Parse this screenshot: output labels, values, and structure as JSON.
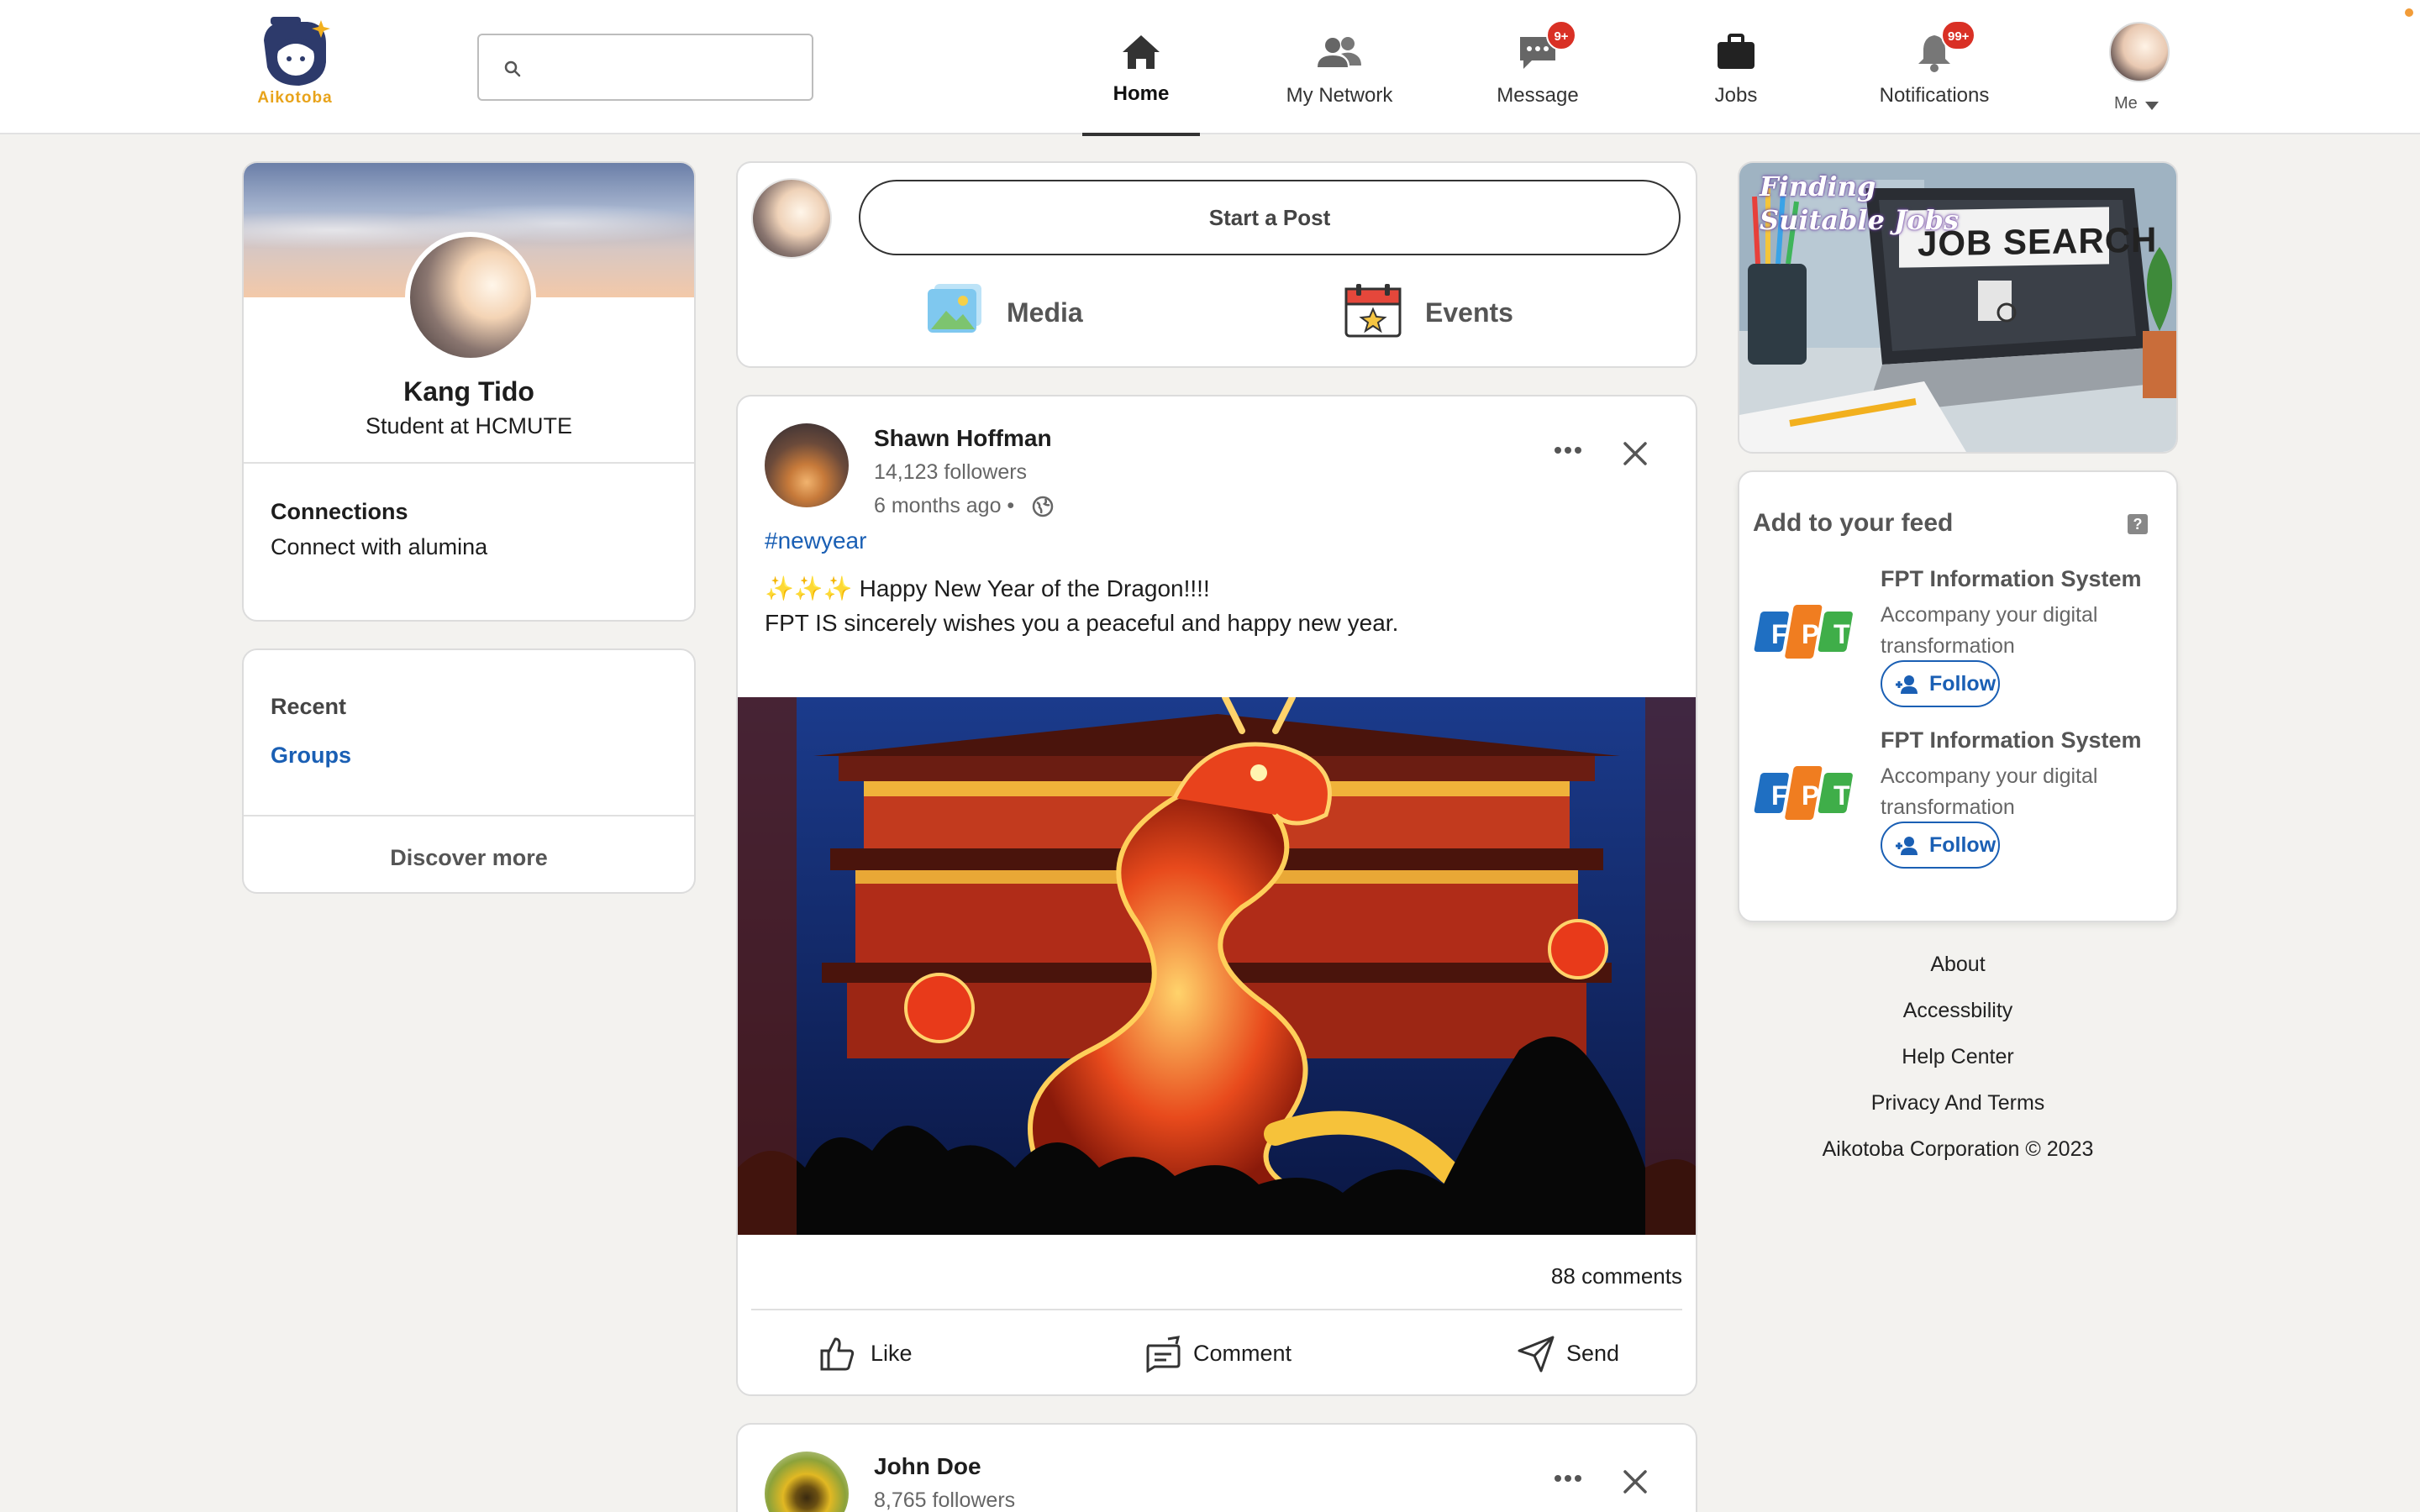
{
  "header": {
    "logo_text": "Aikotoba",
    "search": {
      "placeholder": "",
      "value": ""
    },
    "nav": [
      {
        "id": "home",
        "label": "Home",
        "icon": "home-icon",
        "active": true,
        "badge": ""
      },
      {
        "id": "network",
        "label": "My Network",
        "icon": "people-icon",
        "active": false,
        "badge": ""
      },
      {
        "id": "message",
        "label": "Message",
        "icon": "chat-icon",
        "active": false,
        "badge": "9+"
      },
      {
        "id": "jobs",
        "label": "Jobs",
        "icon": "briefcase-icon",
        "active": false,
        "badge": ""
      },
      {
        "id": "notifications",
        "label": "Notifications",
        "icon": "bell-icon",
        "active": false,
        "badge": "99+"
      }
    ],
    "me_label": "Me"
  },
  "profile": {
    "name": "Kang Tido",
    "subtitle": "Student at HCMUTE",
    "connections_title": "Connections",
    "connections_sub": "Connect with alumina"
  },
  "recent": {
    "title": "Recent",
    "groups_link": "Groups",
    "discover_more": "Discover more"
  },
  "composer": {
    "start_post": "Start a Post",
    "media_label": "Media",
    "events_label": "Events"
  },
  "post": {
    "author": "Shawn Hoffman",
    "followers": "14,123 followers",
    "time": "6 months ago •",
    "hashtag": "#newyear",
    "sparkles": "✨✨✨",
    "line1": "Happy New Year of the Dragon!!!!",
    "line2": "FPT IS sincerely wishes you a peaceful and happy new year.",
    "comments": "88 comments",
    "actions": {
      "like": "Like",
      "comment": "Comment",
      "send": "Send"
    }
  },
  "post2": {
    "author": "John Doe",
    "followers": "8,765 followers"
  },
  "banner": {
    "script_text": "Finding Suitable Jobs",
    "screen_text": "JOB SEARCH"
  },
  "feed": {
    "title": "Add to your feed",
    "help": "?",
    "logo_letters": [
      "F",
      "P",
      "T"
    ],
    "items": [
      {
        "name": "FPT Information System",
        "desc": "Accompany your digital transformation",
        "follow": "Follow"
      },
      {
        "name": "FPT Information System",
        "desc": "Accompany your digital transformation",
        "follow": "Follow"
      }
    ]
  },
  "footer": {
    "links": [
      "About",
      "Accessbility",
      "Help Center",
      "Privacy And Terms",
      "Aikotoba Corporation © 2023"
    ]
  },
  "colors": {
    "accent": "#1a5fb4",
    "badge": "#d93025",
    "logo": "#e8a31a",
    "fpt_blue": "#1f6fc2",
    "fpt_orange": "#f07d20",
    "fpt_green": "#3fae49"
  }
}
